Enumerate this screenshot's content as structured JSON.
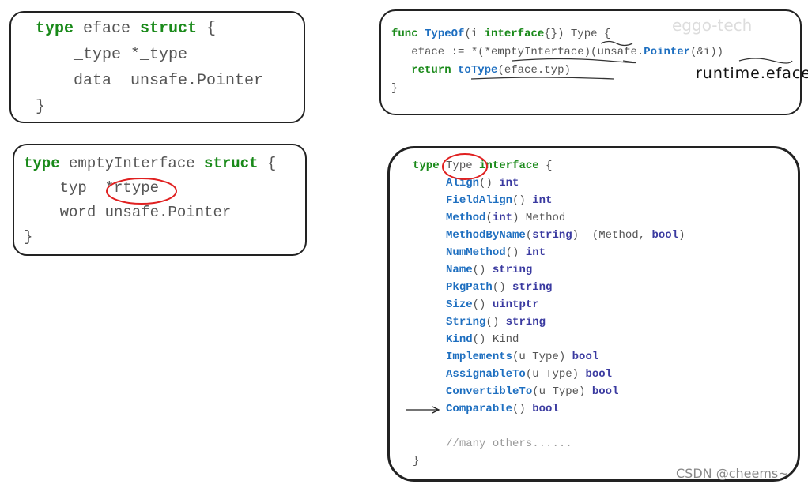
{
  "boxes": [
    {
      "id": "eface",
      "lines": [
        [
          [
            "type",
            "k"
          ],
          [
            " eface ",
            "g"
          ],
          [
            "struct",
            "k"
          ],
          [
            " {",
            "g"
          ]
        ],
        [
          [
            "    _type *_type",
            "g"
          ]
        ],
        [
          [
            "    data  unsafe.Pointer",
            "g"
          ]
        ],
        [
          [
            "}",
            "g"
          ]
        ]
      ]
    },
    {
      "id": "emptyInterface",
      "lines": [
        [
          [
            "type",
            "k"
          ],
          [
            " emptyInterface ",
            "g"
          ],
          [
            "struct",
            "k"
          ],
          [
            " {",
            "g"
          ]
        ],
        [
          [
            "    typ  *rtype",
            "g"
          ]
        ],
        [
          [
            "    word unsafe.Pointer",
            "g"
          ]
        ],
        [
          [
            "}",
            "g"
          ]
        ]
      ]
    },
    {
      "id": "typeof",
      "lines": [
        [
          [
            "func ",
            "k"
          ],
          [
            "TypeOf",
            "f"
          ],
          [
            "(i ",
            "g"
          ],
          [
            "interface",
            "k"
          ],
          [
            "{}) Type {",
            "g"
          ]
        ],
        [
          [
            "   eface := *(*emptyInterface)(unsafe.",
            "g"
          ],
          [
            "Pointer",
            "f"
          ],
          [
            "(&i))",
            "g"
          ]
        ],
        [
          [
            "   ",
            "g"
          ],
          [
            "return ",
            "k"
          ],
          [
            "toType",
            "f"
          ],
          [
            "(eface.typ)",
            "g"
          ]
        ],
        [
          [
            "}",
            "g"
          ]
        ]
      ]
    },
    {
      "id": "type-interface",
      "lines": [
        [
          [
            "type",
            "k"
          ],
          [
            " Type ",
            "g"
          ],
          [
            "interface",
            "k"
          ],
          [
            " {",
            "g"
          ]
        ],
        [
          [
            "     ",
            "g"
          ],
          [
            "Align",
            "f"
          ],
          [
            "() ",
            "g"
          ],
          [
            "int",
            "t"
          ]
        ],
        [
          [
            "     ",
            "g"
          ],
          [
            "FieldAlign",
            "f"
          ],
          [
            "() ",
            "g"
          ],
          [
            "int",
            "t"
          ]
        ],
        [
          [
            "     ",
            "g"
          ],
          [
            "Method",
            "f"
          ],
          [
            "(",
            "g"
          ],
          [
            "int",
            "t"
          ],
          [
            ") Method",
            "g"
          ]
        ],
        [
          [
            "     ",
            "g"
          ],
          [
            "MethodByName",
            "f"
          ],
          [
            "(",
            "g"
          ],
          [
            "string",
            "t"
          ],
          [
            ")  (Method, ",
            "g"
          ],
          [
            "bool",
            "t"
          ],
          [
            ")",
            "g"
          ]
        ],
        [
          [
            "     ",
            "g"
          ],
          [
            "NumMethod",
            "f"
          ],
          [
            "() ",
            "g"
          ],
          [
            "int",
            "t"
          ]
        ],
        [
          [
            "     ",
            "g"
          ],
          [
            "Name",
            "f"
          ],
          [
            "() ",
            "g"
          ],
          [
            "string",
            "t"
          ]
        ],
        [
          [
            "     ",
            "g"
          ],
          [
            "PkgPath",
            "f"
          ],
          [
            "() ",
            "g"
          ],
          [
            "string",
            "t"
          ]
        ],
        [
          [
            "     ",
            "g"
          ],
          [
            "Size",
            "f"
          ],
          [
            "() ",
            "g"
          ],
          [
            "uintptr",
            "t"
          ]
        ],
        [
          [
            "     ",
            "g"
          ],
          [
            "String",
            "f"
          ],
          [
            "() ",
            "g"
          ],
          [
            "string",
            "t"
          ]
        ],
        [
          [
            "     ",
            "g"
          ],
          [
            "Kind",
            "f"
          ],
          [
            "() Kind",
            "g"
          ]
        ],
        [
          [
            "     ",
            "g"
          ],
          [
            "Implements",
            "f"
          ],
          [
            "(u Type) ",
            "g"
          ],
          [
            "bool",
            "t"
          ]
        ],
        [
          [
            "     ",
            "g"
          ],
          [
            "AssignableTo",
            "f"
          ],
          [
            "(u Type) ",
            "g"
          ],
          [
            "bool",
            "t"
          ]
        ],
        [
          [
            "     ",
            "g"
          ],
          [
            "ConvertibleTo",
            "f"
          ],
          [
            "(u Type) ",
            "g"
          ],
          [
            "bool",
            "t"
          ]
        ],
        [
          [
            "     ",
            "g"
          ],
          [
            "Comparable",
            "f"
          ],
          [
            "() ",
            "g"
          ],
          [
            "bool",
            "t"
          ]
        ],
        [
          [
            "",
            "g"
          ]
        ],
        [
          [
            "     ",
            "g"
          ],
          [
            "//many others......",
            "c"
          ]
        ],
        [
          [
            "}",
            "g"
          ]
        ]
      ]
    }
  ],
  "annotation": "runtime.eface",
  "watermarks": {
    "top": "eggo-tech",
    "bottom": "CSDN @cheems~"
  },
  "colors": {
    "keyword": "#1a8a1a",
    "func": "#1e6fc0",
    "type": "#3a3aa0",
    "circle": "#e02020"
  }
}
